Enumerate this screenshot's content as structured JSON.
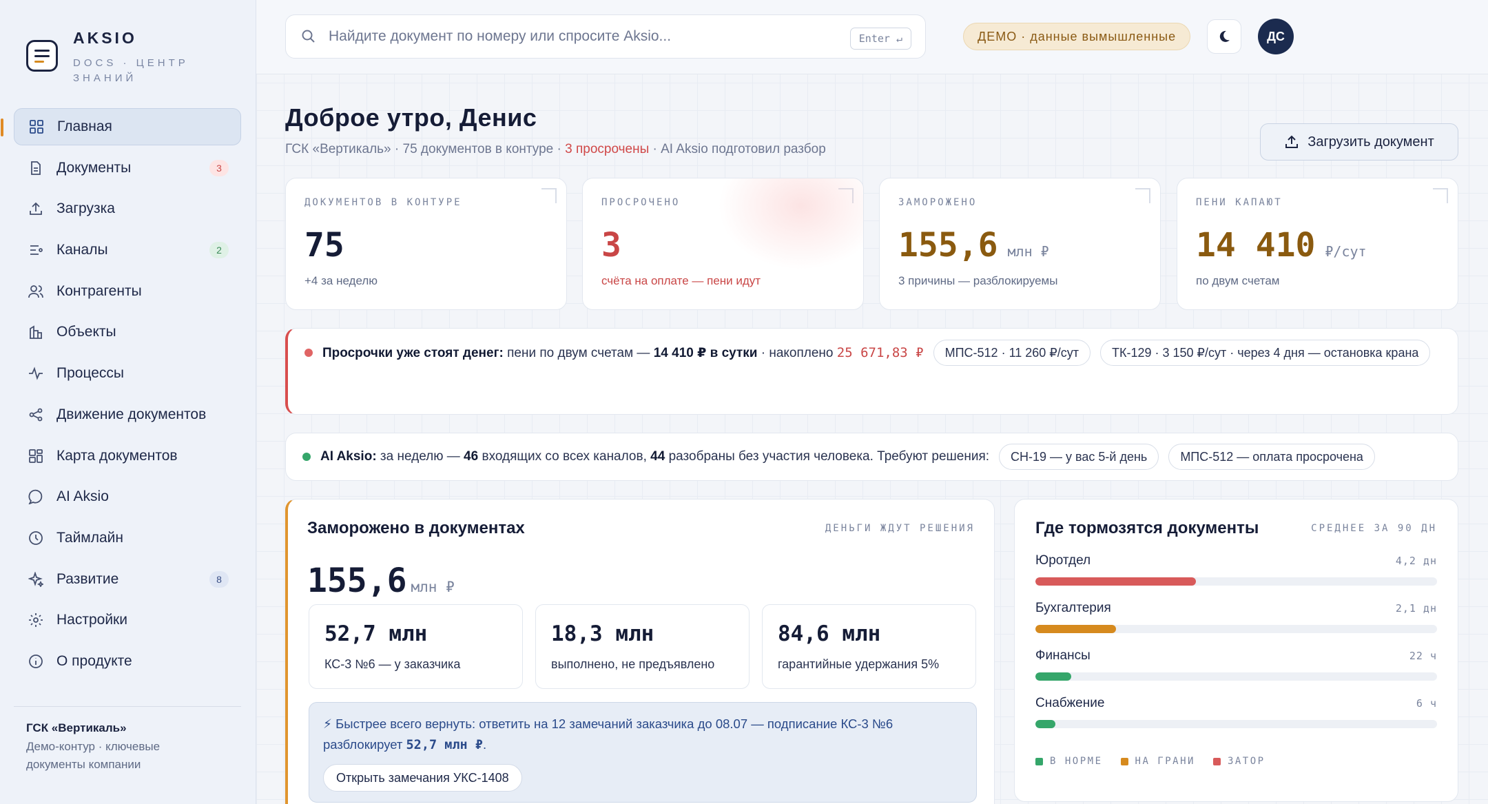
{
  "brand": {
    "name": "AKSIO",
    "subtitle": "DOCS · ЦЕНТР ЗНАНИЙ"
  },
  "sidebar": {
    "items": [
      {
        "label": "Главная",
        "icon": "grid-icon",
        "active": true
      },
      {
        "label": "Документы",
        "icon": "document-icon",
        "badge": "3"
      },
      {
        "label": "Загрузка",
        "icon": "upload-icon"
      },
      {
        "label": "Каналы",
        "icon": "channels-icon",
        "badge": "2"
      },
      {
        "label": "Контрагенты",
        "icon": "users-icon"
      },
      {
        "label": "Объекты",
        "icon": "building-icon"
      },
      {
        "label": "Процессы",
        "icon": "pulse-icon"
      },
      {
        "label": "Движение документов",
        "icon": "share-icon"
      },
      {
        "label": "Карта документов",
        "icon": "map-grid-icon"
      },
      {
        "label": "AI Aksio",
        "icon": "chat-icon"
      },
      {
        "label": "Таймлайн",
        "icon": "clock-icon"
      },
      {
        "label": "Развитие",
        "icon": "sparkle-icon",
        "badge": "8"
      },
      {
        "label": "Настройки",
        "icon": "gear-icon"
      },
      {
        "label": "О продукте",
        "icon": "info-icon"
      }
    ],
    "footer": {
      "org": "ГСК «Вертикаль»",
      "desc": "Демо-контур · ключевые документы компании"
    }
  },
  "topbar": {
    "search_placeholder": "Найдите документ по номеру или спросите Aksio...",
    "search_key": "Enter ↵",
    "demo_label": "ДЕМО · данные вымышленные",
    "avatar": "ДС"
  },
  "header": {
    "greeting": "Доброе утро, Денис",
    "sub_prefix": "ГСК «Вертикаль» · 75 документов в контуре · ",
    "sub_overdue": "3 просрочены",
    "sub_suffix": " · AI Aksio подготовил разбор",
    "upload_label": "Загрузить документ"
  },
  "kpis": [
    {
      "label": "ДОКУМЕНТОВ В КОНТУРЕ",
      "value": "75",
      "unit": "",
      "note": "+4 за неделю"
    },
    {
      "label": "ПРОСРОЧЕНО",
      "value": "3",
      "unit": "",
      "note": "счёта на оплате — пени идут"
    },
    {
      "label": "ЗАМОРОЖЕНО",
      "value": "155,6",
      "unit": "млн ₽",
      "note": "3 причины — разблокируемы"
    },
    {
      "label": "ПЕНИ КАПАЮТ",
      "value": "14 410",
      "unit": "₽/сут",
      "note": "по двум счетам"
    }
  ],
  "alert": {
    "lead": "Просрочки уже стоят денег:",
    "t1": "пени по двум счетам —",
    "amount": "14 410 ₽ в сутки",
    "t2": "· накоплено",
    "accumulated": "25 671,83 ₽",
    "chips": [
      "МПС-512 · 11 260 ₽/сут",
      "ТК-129 · 3 150 ₽/сут · через 4 дня — остановка крана"
    ],
    "color": "#d84e4e"
  },
  "ai": {
    "lead": "AI Aksio:",
    "t1": "за неделю —",
    "n1": "46",
    "t2": "входящих со всех каналов,",
    "n2": "44",
    "t3": "разобраны без участия человека. Требуют решения:",
    "chips": [
      "СН-19 — у вас 5-й день",
      "МПС-512 — оплата просрочена"
    ],
    "color": "#35a66a"
  },
  "frozen": {
    "title": "Заморожено в документах",
    "tag": "ДЕНЬГИ ЖДУТ РЕШЕНИЯ",
    "value": "155,6",
    "unit": "млн ₽",
    "items": [
      {
        "value": "52,7 млн",
        "desc": "КС-3 №6 — у заказчика"
      },
      {
        "value": "18,3 млн",
        "desc": "выполнено, не предъявлено"
      },
      {
        "value": "84,6 млн",
        "desc": "гарантийные удержания 5%"
      }
    ],
    "hint_text": "⚡ Быстрее всего вернуть: ответить на 12 замечаний заказчика до 08.07 — подписание КС-3 №6 разблокирует",
    "hint_amount": "52,7 млн ₽",
    "hint_end": ".",
    "hint_button": "Открыть замечания УКС-1408"
  },
  "slow": {
    "title": "Где тормозятся документы",
    "tag": "СРЕДНЕЕ ЗА 90 ДН",
    "departments": [
      {
        "name": "Юротдел",
        "value": "4,2 дн",
        "fill": 0.4,
        "status": "zator"
      },
      {
        "name": "Бухгалтерия",
        "value": "2,1 дн",
        "fill": 0.2,
        "status": "grani"
      },
      {
        "name": "Финансы",
        "value": "22 ч",
        "fill": 0.09,
        "status": "norm"
      },
      {
        "name": "Снабжение",
        "value": "6 ч",
        "fill": 0.05,
        "status": "norm"
      }
    ],
    "legend": [
      {
        "label": "В НОРМЕ",
        "color": "#35a66a"
      },
      {
        "label": "НА ГРАНИ",
        "color": "#d68a1e"
      },
      {
        "label": "ЗАТОР",
        "color": "#d85a5a"
      }
    ]
  }
}
